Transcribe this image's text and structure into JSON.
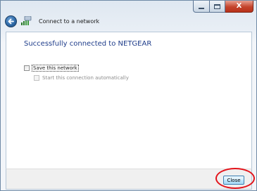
{
  "window": {
    "title": "Connect to a network",
    "caption_buttons": [
      "minimize",
      "maximize",
      "close"
    ],
    "close_glyph": "X"
  },
  "icons": {
    "back": "back-arrow-icon",
    "network": "network-icon"
  },
  "main": {
    "heading": "Successfully connected to NETGEAR",
    "save_network": {
      "label": "Save this network",
      "checked": false
    },
    "start_auto": {
      "label": "Start this connection automatically",
      "checked": false,
      "enabled": false
    }
  },
  "footer": {
    "close_label": "Close"
  },
  "colors": {
    "heading": "#1e3c8a",
    "highlight_ring": "#e3141b",
    "close_caption": "#c4442c"
  }
}
